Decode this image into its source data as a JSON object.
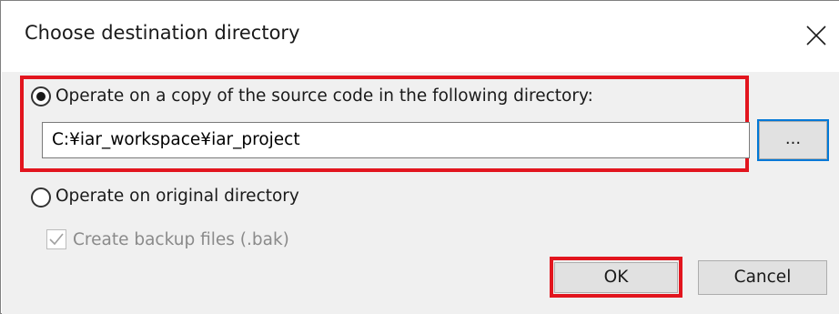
{
  "dialog": {
    "title": "Choose destination directory",
    "close_icon": "close-icon"
  },
  "options": {
    "copy_option": {
      "label": "Operate on a copy of the source code in the following directory:",
      "selected": true
    },
    "directory_path": "C:¥iar_workspace¥iar_project",
    "browse_label": "...",
    "original_option": {
      "label": "Operate on original directory",
      "selected": false
    },
    "backup_checkbox": {
      "label": "Create backup files (.bak)",
      "checked": true,
      "enabled": false
    }
  },
  "buttons": {
    "ok_label": "OK",
    "cancel_label": "Cancel"
  },
  "colors": {
    "highlight": "#e2151e",
    "focus_border": "#0078d7",
    "button_face": "#e1e1e1",
    "dialog_background": "#f0f0f0"
  }
}
